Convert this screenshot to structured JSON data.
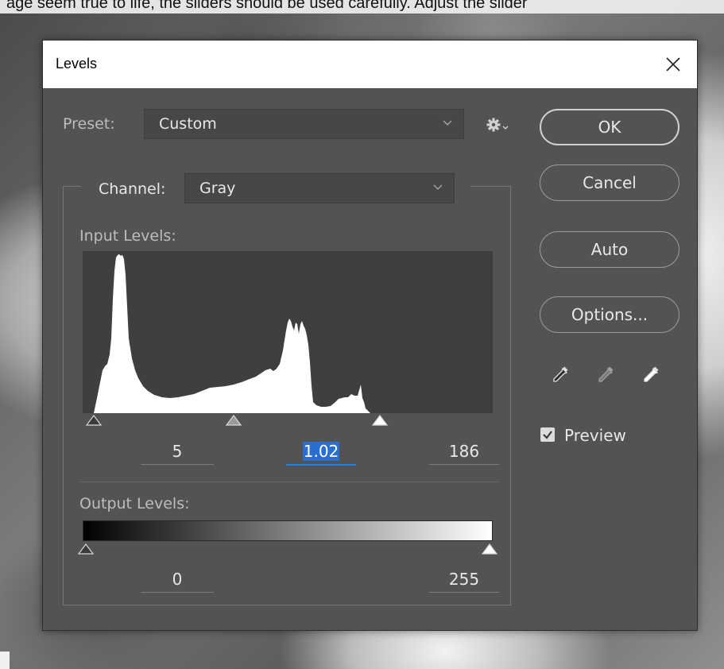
{
  "background": {
    "caption": "age seem true to life, the sliders should be used carefully. Adjust the slider"
  },
  "dialog": {
    "title": "Levels",
    "close_icon": "close-icon",
    "preset": {
      "label": "Preset:",
      "value": "Custom"
    },
    "gear_icon": "gear-icon",
    "channel": {
      "label": "Channel:",
      "value": "Gray"
    },
    "input_levels": {
      "label": "Input Levels:",
      "black": "5",
      "gamma": "1.02",
      "white": "186",
      "black_level": 5,
      "gamma_level": 1.02,
      "white_level": 186
    },
    "output_levels": {
      "label": "Output Levels:",
      "black": "0",
      "white": "255",
      "black_level": 0,
      "white_level": 255
    },
    "buttons": {
      "ok": "OK",
      "cancel": "Cancel",
      "auto": "Auto",
      "options": "Options..."
    },
    "eyedroppers": [
      "black-point-eyedropper-icon",
      "gray-point-eyedropper-icon",
      "white-point-eyedropper-icon"
    ],
    "preview": {
      "label": "Preview",
      "checked": true
    }
  },
  "colors": {
    "dialog_bg": "#535353",
    "histogram_bg": "#3f3f3f",
    "histogram_fill": "#ffffff",
    "accent": "#2a6fd0"
  }
}
